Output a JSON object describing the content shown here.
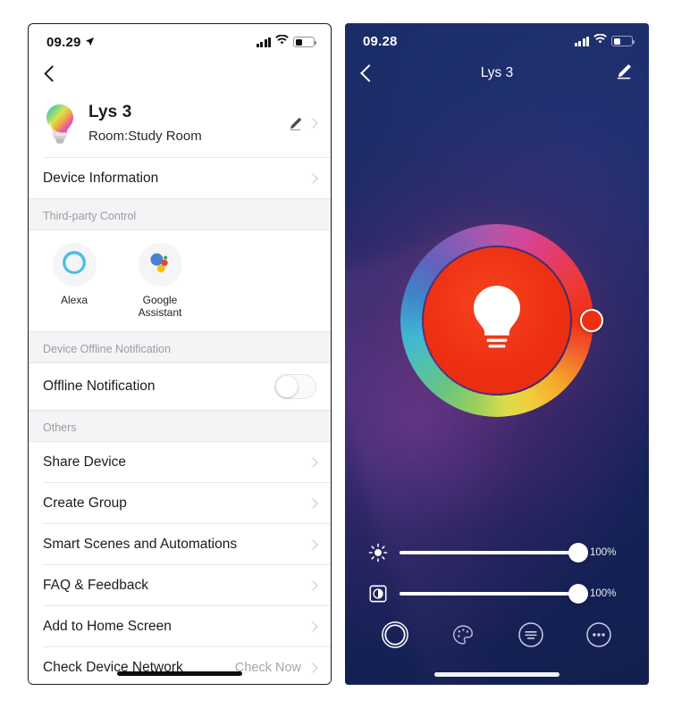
{
  "left_phone": {
    "status": {
      "time": "09.29",
      "location_icon": "location-arrow-icon",
      "signal_icon": "cellular-signal-icon",
      "wifi_icon": "wifi-icon",
      "battery_icon": "battery-icon"
    },
    "nav": {
      "back_icon": "chevron-left-icon"
    },
    "device": {
      "icon": "smart-bulb-icon",
      "name": "Lys 3",
      "room": "Room:Study Room",
      "edit_icon": "pencil-icon",
      "chevron": "chevron-right-icon"
    },
    "rows_top": [
      {
        "label": "Device Information",
        "value": "",
        "chevron": true
      }
    ],
    "sections": [
      {
        "header": "Third-party Control"
      },
      {
        "header": "Device Offline Notification"
      },
      {
        "header": "Others"
      }
    ],
    "third_party": [
      {
        "label": "Alexa",
        "icon": "alexa-icon"
      },
      {
        "label": "Google\nAssistant",
        "label_line1": "Google",
        "label_line2": "Assistant",
        "icon": "google-assistant-icon"
      }
    ],
    "offline": {
      "label": "Offline Notification",
      "toggle_state": "off"
    },
    "rows_others": [
      {
        "label": "Share Device",
        "value": "",
        "chevron": true
      },
      {
        "label": "Create Group",
        "value": "",
        "chevron": true
      },
      {
        "label": "Smart Scenes and Automations",
        "value": "",
        "chevron": true
      },
      {
        "label": "FAQ & Feedback",
        "value": "",
        "chevron": true
      },
      {
        "label": "Add to Home Screen",
        "value": "",
        "chevron": true
      },
      {
        "label": "Check Device Network",
        "value": "Check Now",
        "chevron": true
      }
    ]
  },
  "right_phone": {
    "status": {
      "time": "09.28",
      "signal_icon": "cellular-signal-icon",
      "wifi_icon": "wifi-icon",
      "battery_icon": "battery-icon"
    },
    "nav": {
      "back_icon": "chevron-left-icon",
      "title": "Lys 3",
      "edit_icon": "pencil-icon"
    },
    "color_wheel": {
      "selected_color": "#EE2F12",
      "handle_angle_deg": 0,
      "center_icon": "light-bulb-icon"
    },
    "sliders": [
      {
        "name": "brightness",
        "icon": "brightness-sun-icon",
        "value": 100,
        "value_label": "100%"
      },
      {
        "name": "color-temperature",
        "icon": "contrast-square-icon",
        "value": 100,
        "value_label": "100%"
      }
    ],
    "tabs": [
      {
        "name": "white-light-tab",
        "icon": "circle-ring-icon",
        "active": true
      },
      {
        "name": "color-tab",
        "icon": "palette-icon",
        "active": false
      },
      {
        "name": "scene-tab",
        "icon": "menu-lines-circle-icon",
        "active": false
      },
      {
        "name": "more-tab",
        "icon": "more-dots-circle-icon",
        "active": false
      }
    ]
  },
  "colors": {
    "accent_red": "#EE2F12",
    "background_navy": "#1B2A64",
    "list_bg": "#FFFFFF",
    "section_bg": "#F4F4F6",
    "muted_text": "#9C9CA1"
  }
}
